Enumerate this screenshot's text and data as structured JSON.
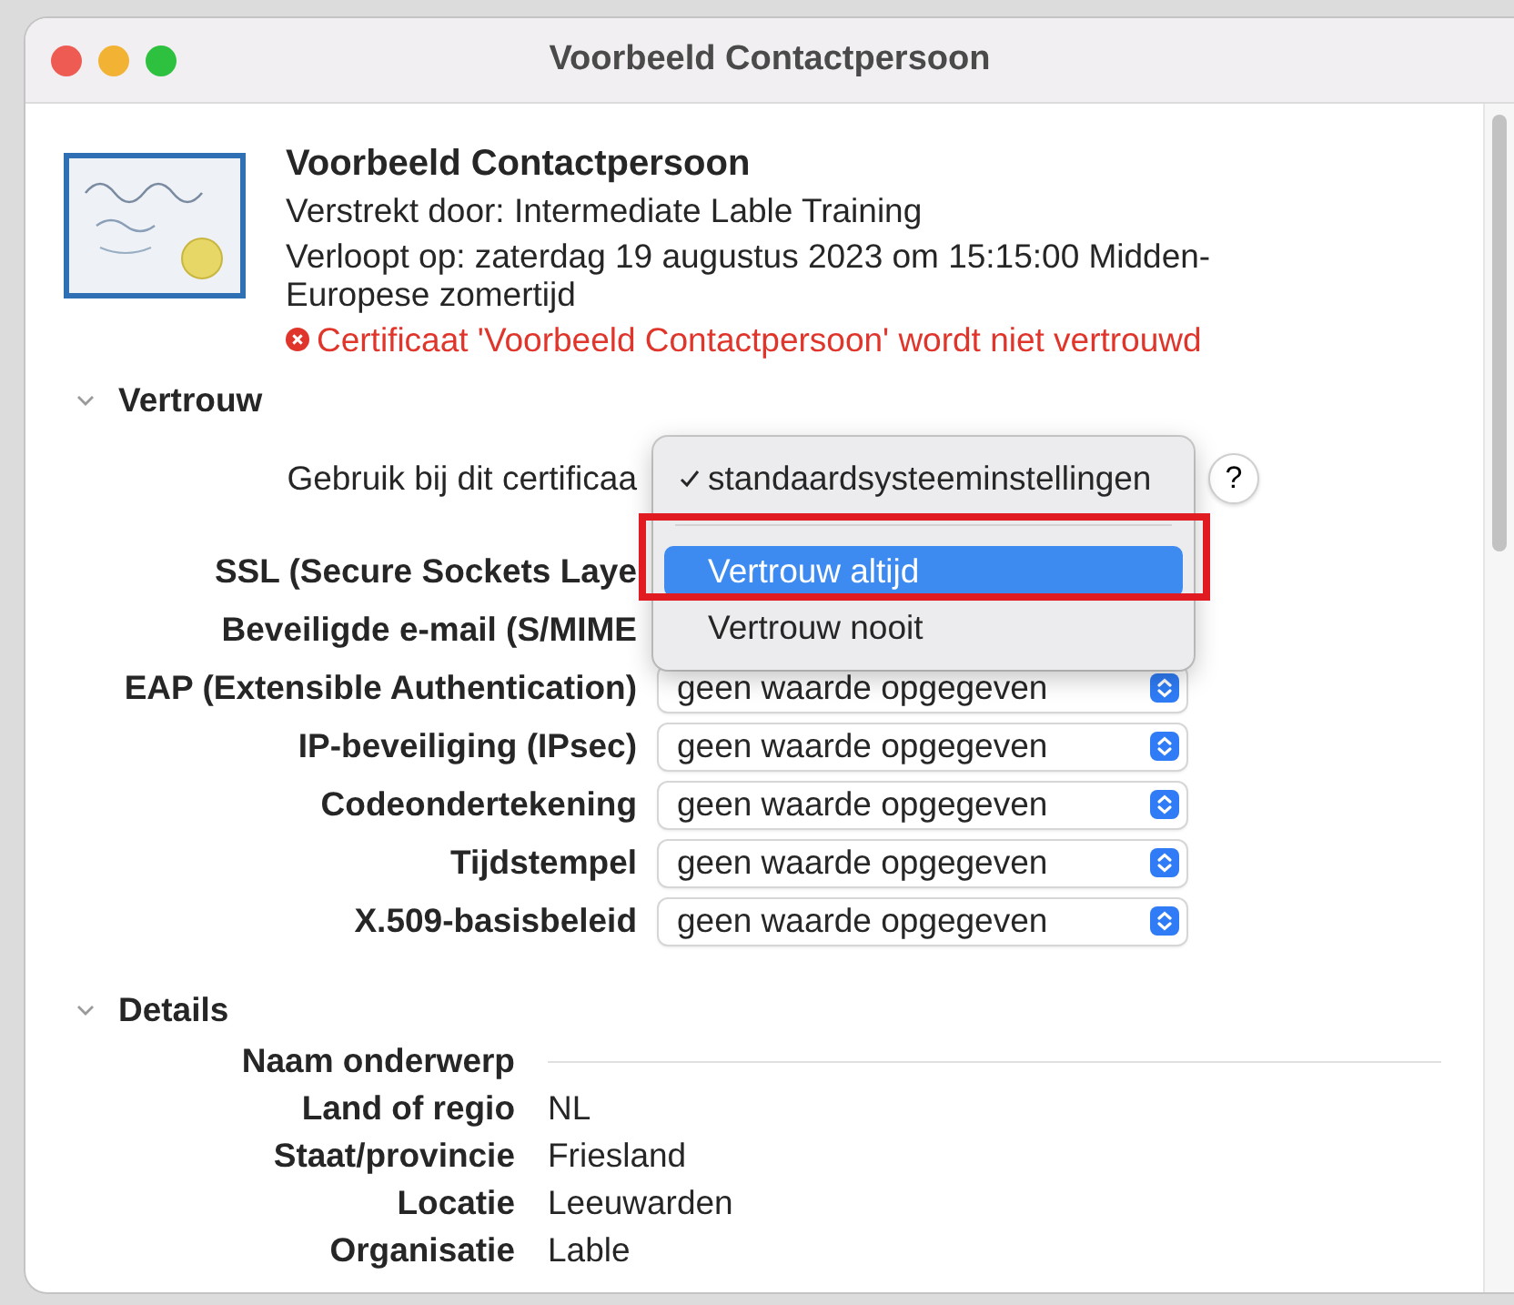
{
  "window": {
    "title": "Voorbeeld Contactpersoon"
  },
  "certificate": {
    "name": "Voorbeeld Contactpersoon",
    "issued_by": "Verstrekt door: Intermediate Lable Training",
    "expires": "Verloopt op: zaterdag 19 augustus 2023 om 15:15:00 Midden-Europese zomertijd",
    "warning": "Certificaat 'Voorbeeld Contactpersoon' wordt niet vertrouwd"
  },
  "trust": {
    "title": "Vertrouw",
    "expanded": true,
    "use_label": "Gebruik bij dit certificaa",
    "help_button": "?",
    "menu": [
      {
        "label": "standaardsysteeminstellingen",
        "checked": true,
        "selected": false
      },
      {
        "label": "Vertrouw altijd",
        "checked": false,
        "selected": true
      },
      {
        "label": "Vertrouw nooit",
        "checked": false,
        "selected": false
      }
    ],
    "policies": [
      {
        "label": "SSL (Secure Sockets Laye"
      },
      {
        "label": "Beveiligde e-mail (S/MIME"
      },
      {
        "label": "EAP (Extensible Authentication)",
        "value": "geen waarde opgegeven"
      },
      {
        "label": "IP-beveiliging (IPsec)",
        "value": "geen waarde opgegeven"
      },
      {
        "label": "Codeondertekening",
        "value": "geen waarde opgegeven"
      },
      {
        "label": "Tijdstempel",
        "value": "geen waarde opgegeven"
      },
      {
        "label": "X.509-basisbeleid",
        "value": "geen waarde opgegeven"
      }
    ]
  },
  "details": {
    "title": "Details",
    "expanded": true,
    "fields": [
      {
        "label": "Naam onderwerp",
        "kind": "heading"
      },
      {
        "label": "Land of regio",
        "value": "NL",
        "kind": "field"
      },
      {
        "label": "Staat/provincie",
        "value": "Friesland",
        "kind": "field"
      },
      {
        "label": "Locatie",
        "value": "Leeuwarden",
        "kind": "field"
      },
      {
        "label": "Organisatie",
        "value": "Lable",
        "kind": "field"
      }
    ]
  }
}
